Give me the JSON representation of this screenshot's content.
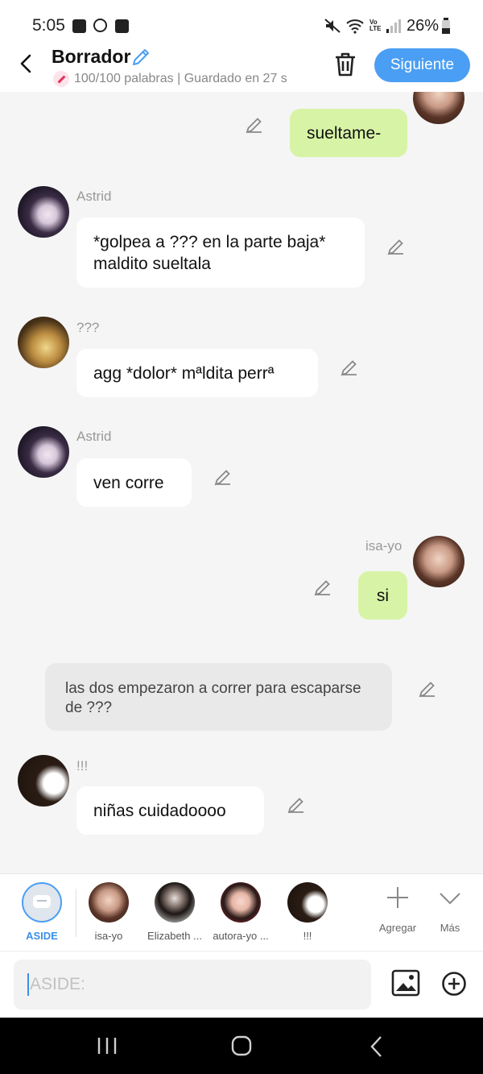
{
  "status": {
    "time": "5:05",
    "battery": "26%"
  },
  "header": {
    "title": "Borrador",
    "subtitle": "100/100 palabras | Guardado en 27 s",
    "next_label": "Siguiente"
  },
  "messages": [
    {
      "speaker": "",
      "text": "sueltame-",
      "side": "right"
    },
    {
      "speaker": "Astrid",
      "text": "*golpea a ??? en la parte baja* maldito sueltala",
      "side": "left"
    },
    {
      "speaker": "???",
      "text": "agg *dolor* mªldita perrª",
      "side": "left"
    },
    {
      "speaker": "Astrid",
      "text": "ven corre",
      "side": "left"
    },
    {
      "speaker": "isa-yo",
      "text": "si",
      "side": "right"
    },
    {
      "speaker": "",
      "text": "las dos empezaron a correr para escaparse de ???",
      "side": "narration"
    },
    {
      "speaker": "!!!",
      "text": "niñas cuidadoooo",
      "side": "left"
    }
  ],
  "characters": [
    {
      "label": "ASIDE"
    },
    {
      "label": "isa-yo"
    },
    {
      "label": "Elizabeth ..."
    },
    {
      "label": "autora-yo ..."
    },
    {
      "label": "!!!"
    }
  ],
  "actions": {
    "add_label": "Agregar",
    "more_label": "Más"
  },
  "input": {
    "placeholder": "ASIDE:"
  },
  "colors": {
    "accent": "#4a9ef3",
    "my_bubble": "#d7f4a6",
    "narration": "#e9e9e9"
  },
  "icons": [
    "image-icon",
    "whatsapp-icon",
    "checkbox-icon",
    "mute-icon",
    "wifi-icon",
    "volte-icon",
    "signal-icon",
    "battery-icon",
    "back-arrow-icon",
    "pencil-icon",
    "trash-icon",
    "aside-icon",
    "plus-icon",
    "chevron-down-icon",
    "gallery-icon",
    "add-circle-icon",
    "recents-icon",
    "home-icon",
    "nav-back-icon"
  ]
}
